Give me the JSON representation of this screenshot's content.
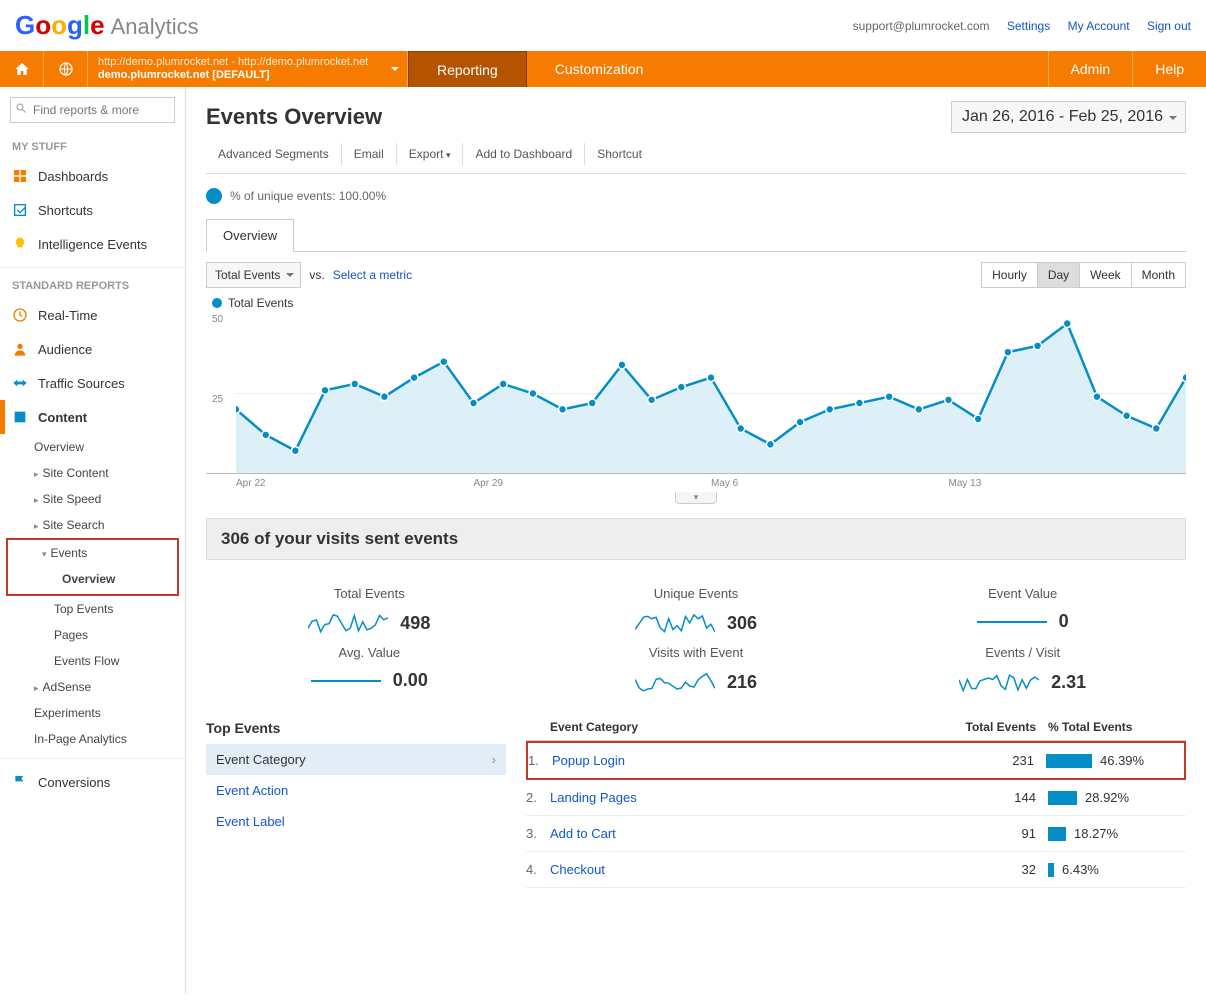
{
  "header": {
    "email": "support@plumrocket.com",
    "links": {
      "settings": "Settings",
      "account": "My Account",
      "signout": "Sign out"
    },
    "logo_sub": "Analytics"
  },
  "nav": {
    "property_line1": "http://demo.plumrocket.net - http://demo.plumrocket.net",
    "property_line2": "demo.plumrocket.net [DEFAULT]",
    "reporting": "Reporting",
    "customization": "Customization",
    "admin": "Admin",
    "help": "Help"
  },
  "sidebar": {
    "search_placeholder": "Find reports & more",
    "mystuff_title": "MY STUFF",
    "mystuff": {
      "dashboards": "Dashboards",
      "shortcuts": "Shortcuts",
      "intel": "Intelligence Events"
    },
    "std_title": "STANDARD REPORTS",
    "std": {
      "realtime": "Real-Time",
      "audience": "Audience",
      "traffic": "Traffic Sources",
      "content": "Content",
      "conversions": "Conversions"
    },
    "content_sub": {
      "overview": "Overview",
      "site_content": "Site Content",
      "site_speed": "Site Speed",
      "site_search": "Site Search",
      "events": "Events",
      "events_overview": "Overview",
      "top_events": "Top Events",
      "pages": "Pages",
      "events_flow": "Events Flow",
      "adsense": "AdSense",
      "experiments": "Experiments",
      "inpage": "In-Page Analytics"
    }
  },
  "page": {
    "title": "Events Overview",
    "date_range": "Jan 26, 2016 - Feb 25, 2016",
    "toolbar": {
      "adv": "Advanced Segments",
      "email": "Email",
      "export": "Export",
      "add": "Add to Dashboard",
      "shortcut": "Shortcut"
    },
    "segment_label": "% of unique events: 100.00%",
    "tab_overview": "Overview",
    "metric_dd": "Total Events",
    "vs": "vs.",
    "select_metric": "Select a metric",
    "gran": {
      "hourly": "Hourly",
      "day": "Day",
      "week": "Week",
      "month": "Month"
    },
    "chart_legend": "Total Events"
  },
  "chart_data": {
    "type": "line",
    "title": "Total Events",
    "ylabel": "",
    "xlabel": "",
    "ylim": [
      0,
      50
    ],
    "yticks": [
      25,
      50
    ],
    "categories": [
      "Apr 22",
      "Apr 29",
      "May 6",
      "May 13"
    ],
    "values": [
      20,
      12,
      7,
      26,
      28,
      24,
      30,
      35,
      22,
      28,
      25,
      20,
      22,
      34,
      23,
      27,
      30,
      14,
      9,
      16,
      20,
      22,
      24,
      20,
      23,
      17,
      38,
      40,
      47,
      24,
      18,
      14,
      30
    ]
  },
  "summary": {
    "heading": "306 of your visits sent events",
    "metrics": [
      {
        "label": "Total Events",
        "value": "498",
        "spark": true
      },
      {
        "label": "Unique Events",
        "value": "306",
        "spark": true
      },
      {
        "label": "Event Value",
        "value": "0",
        "spark": false
      },
      {
        "label": "Avg. Value",
        "value": "0.00",
        "spark": false
      },
      {
        "label": "Visits with Event",
        "value": "216",
        "spark": true
      },
      {
        "label": "Events / Visit",
        "value": "2.31",
        "spark": true
      }
    ]
  },
  "bottom": {
    "top_events_title": "Top Events",
    "dims": {
      "cat": "Event Category",
      "action": "Event Action",
      "label": "Event Label"
    },
    "table_header": {
      "cat": "Event Category",
      "total": "Total Events",
      "pct": "% Total Events"
    },
    "rows": [
      {
        "idx": "1",
        "cat": "Popup Login",
        "total": "231",
        "pct": "46.39%",
        "bar": 46
      },
      {
        "idx": "2",
        "cat": "Landing Pages",
        "total": "144",
        "pct": "28.92%",
        "bar": 29
      },
      {
        "idx": "3",
        "cat": "Add to Cart",
        "total": "91",
        "pct": "18.27%",
        "bar": 18
      },
      {
        "idx": "4",
        "cat": "Checkout",
        "total": "32",
        "pct": "6.43%",
        "bar": 6
      }
    ]
  }
}
